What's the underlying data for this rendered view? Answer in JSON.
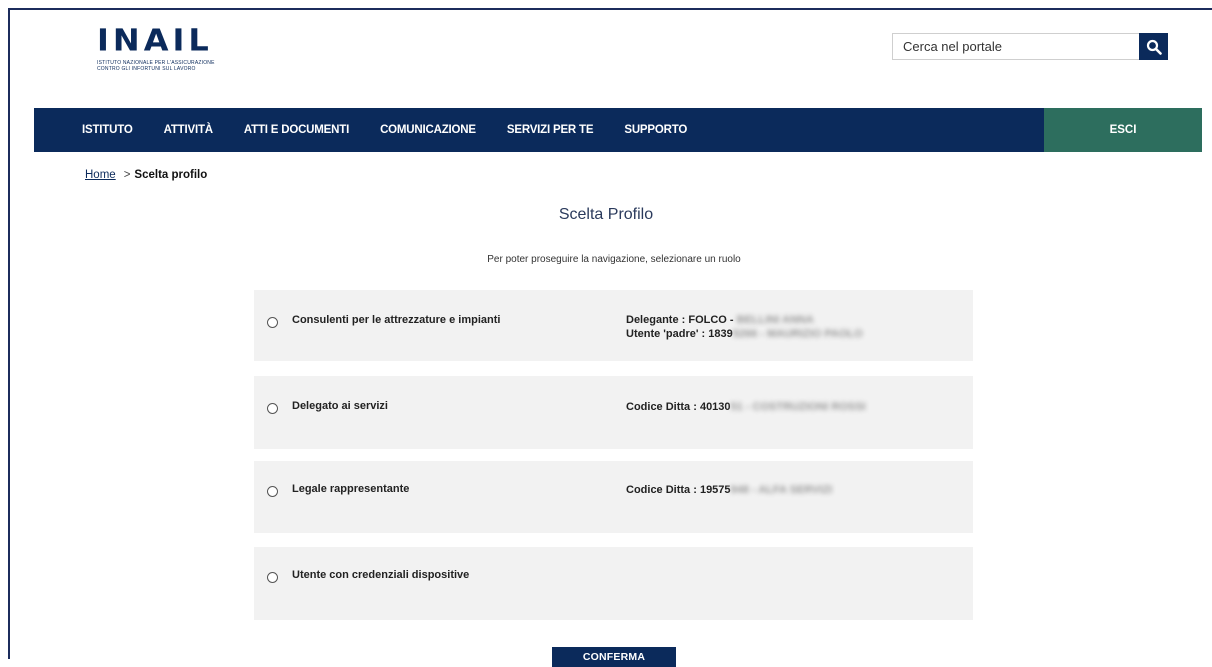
{
  "logo": {
    "wordmark": "INAIL",
    "subtitle_line1": "ISTITUTO NAZIONALE PER L'ASSICURAZIONE",
    "subtitle_line2": "CONTRO GLI INFORTUNI SUL LAVORO"
  },
  "search": {
    "placeholder": "Cerca nel portale",
    "value": ""
  },
  "nav": {
    "items": [
      "ISTITUTO",
      "ATTIVITÀ",
      "ATTI E DOCUMENTI",
      "COMUNICAZIONE",
      "SERVIZI PER TE",
      "SUPPORTO"
    ],
    "exit_label": "ESCI"
  },
  "breadcrumb": {
    "home": "Home",
    "separator": ">",
    "current": "Scelta profilo"
  },
  "page": {
    "title": "Scelta Profilo",
    "subtitle": "Per poter proseguire la navigazione, selezionare un ruolo"
  },
  "profiles": [
    {
      "label": "Consulenti per le attrezzature e impianti",
      "detail_line1": "Delegante : FOLCO - ",
      "detail_line1_blurred": "BELLINI ANNA",
      "detail_line2": "Utente 'padre' : 1839",
      "detail_line2_blurred": "5266 - MAURIZIO PAOLO"
    },
    {
      "label": "Delegato ai servizi",
      "detail_line1": "Codice Ditta : 40130",
      "detail_line1_blurred": "51 - COSTRUZIONI ROSSI"
    },
    {
      "label": "Legale rappresentante",
      "detail_line1": "Codice Ditta : 19575",
      "detail_line1_blurred": "948 - ALFA SERVIZI"
    },
    {
      "label": "Utente con credenziali dispositive"
    }
  ],
  "confirm_label": "CONFERMA",
  "colors": {
    "primary": "#0b2a5b",
    "exit": "#2d6e5e",
    "option_bg": "#f2f2f2"
  }
}
